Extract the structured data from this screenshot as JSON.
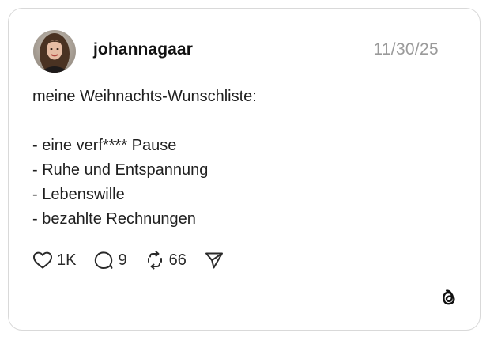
{
  "post": {
    "username": "johannagaar",
    "date": "11/30/25",
    "lines": [
      "meine Weihnachts-Wunschliste:",
      "",
      "- eine verf**** Pause",
      "- Ruhe und Entspannung",
      "- Lebenswille",
      "- bezahlte Rechnungen"
    ]
  },
  "actions": {
    "likes": "1K",
    "replies": "9",
    "reposts": "66"
  },
  "icons": {
    "like": "heart-icon",
    "reply": "comment-icon",
    "repost": "repost-icon",
    "share": "send-icon",
    "brand": "threads-logo-icon"
  },
  "colors": {
    "border": "#d9d9d9",
    "date_text": "#9a9a9a",
    "text": "#1f1f1f"
  }
}
